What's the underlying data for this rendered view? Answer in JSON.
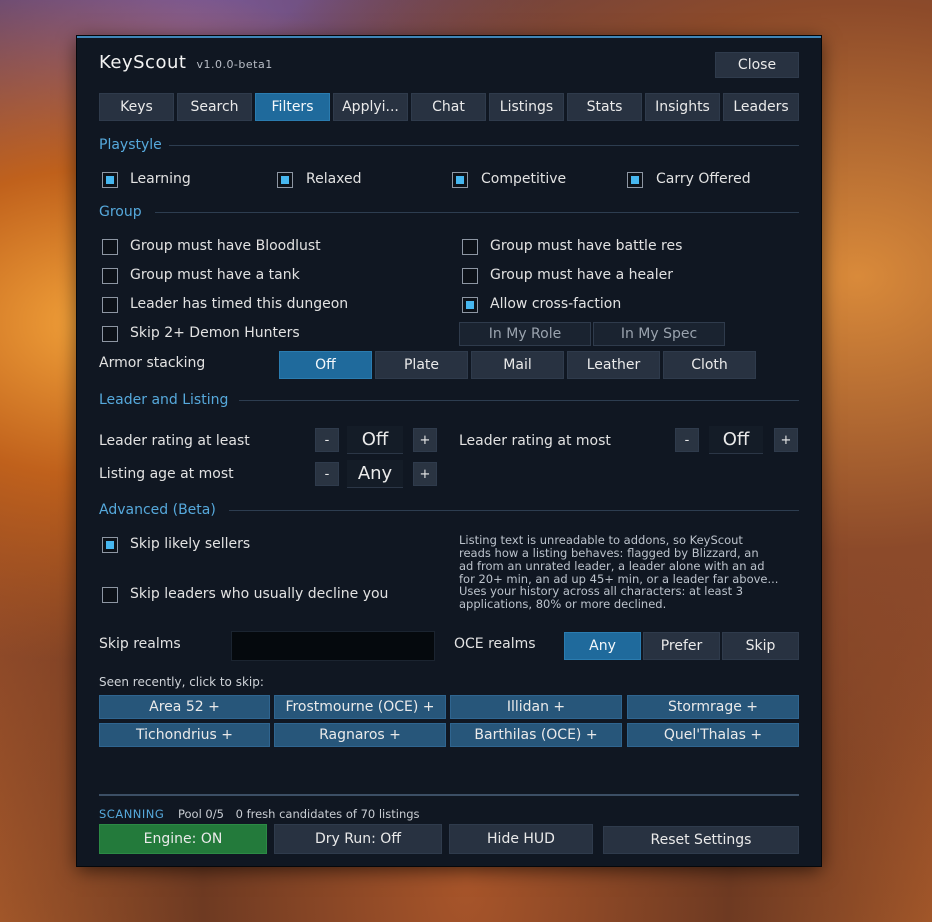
{
  "app": {
    "title": "KeyScout",
    "version": "v1.0.0-beta1",
    "close_label": "Close"
  },
  "tabs": [
    {
      "label": "Keys",
      "active": false
    },
    {
      "label": "Search",
      "active": false
    },
    {
      "label": "Filters",
      "active": true
    },
    {
      "label": "Applyi...",
      "active": false
    },
    {
      "label": "Chat",
      "active": false
    },
    {
      "label": "Listings",
      "active": false
    },
    {
      "label": "Stats",
      "active": false
    },
    {
      "label": "Insights",
      "active": false
    },
    {
      "label": "Leaders",
      "active": false
    }
  ],
  "playstyle": {
    "heading": "Playstyle",
    "options": [
      {
        "label": "Learning",
        "checked": true
      },
      {
        "label": "Relaxed",
        "checked": true
      },
      {
        "label": "Competitive",
        "checked": true
      },
      {
        "label": "Carry Offered",
        "checked": true
      }
    ]
  },
  "group": {
    "heading": "Group",
    "left": [
      {
        "label": "Group must have Bloodlust",
        "checked": false
      },
      {
        "label": "Group must have a tank",
        "checked": false
      },
      {
        "label": "Leader has timed this dungeon",
        "checked": false
      },
      {
        "label": "Skip 2+ Demon Hunters",
        "checked": false
      }
    ],
    "right": [
      {
        "label": "Group must have battle res",
        "checked": false
      },
      {
        "label": "Group must have a healer",
        "checked": false
      },
      {
        "label": "Allow cross-faction",
        "checked": true
      }
    ],
    "role_toggle": [
      "In My Role",
      "In My Spec"
    ],
    "armor_label": "Armor stacking",
    "armor_options": [
      {
        "label": "Off",
        "active": true
      },
      {
        "label": "Plate",
        "active": false
      },
      {
        "label": "Mail",
        "active": false
      },
      {
        "label": "Leather",
        "active": false
      },
      {
        "label": "Cloth",
        "active": false
      }
    ]
  },
  "leader_listing": {
    "heading": "Leader and Listing",
    "rating_min_label": "Leader rating at least",
    "rating_min_value": "Off",
    "rating_max_label": "Leader rating at most",
    "rating_max_value": "Off",
    "age_label": "Listing age at most",
    "age_value": "Any",
    "minus": "-",
    "plus": "+"
  },
  "advanced": {
    "heading": "Advanced (Beta)",
    "skip_sellers": {
      "label": "Skip likely sellers",
      "checked": true
    },
    "skip_sellers_help": [
      "Listing text is unreadable to addons, so KeyScout",
      "reads how a listing behaves: flagged by Blizzard, an",
      "ad from an unrated leader, a leader alone with an ad",
      "for 20+ min, an ad up 45+ min, or a leader far above..."
    ],
    "skip_decline": {
      "label": "Skip leaders who usually decline you",
      "checked": false
    },
    "skip_decline_help": [
      "Uses your history across all characters: at least 3",
      "applications, 80% or more declined."
    ],
    "skip_realms_label": "Skip realms",
    "skip_realms_value": "",
    "oce_label": "OCE realms",
    "oce_options": [
      {
        "label": "Any",
        "active": true
      },
      {
        "label": "Prefer",
        "active": false
      },
      {
        "label": "Skip",
        "active": false
      }
    ],
    "seen_label": "Seen recently, click to skip:",
    "realms": [
      "Area 52  +",
      "Frostmourne (OCE)  +",
      "Illidan  +",
      "Stormrage  +",
      "Tichondrius  +",
      "Ragnaros  +",
      "Barthilas (OCE)  +",
      "Quel'Thalas  +"
    ]
  },
  "status": {
    "state": "SCANNING",
    "pool": "Pool 0/5",
    "candidates": "0 fresh candidates of 70 listings"
  },
  "footer": {
    "engine": "Engine: ON",
    "dry_run": "Dry Run: Off",
    "hide_hud": "Hide HUD",
    "reset": "Reset Settings"
  },
  "colors": {
    "accent": "#56a9dc",
    "active_button": "#1f6a9c",
    "engine_on": "#237a3b",
    "checkbox_fill": "#46b6ee"
  }
}
